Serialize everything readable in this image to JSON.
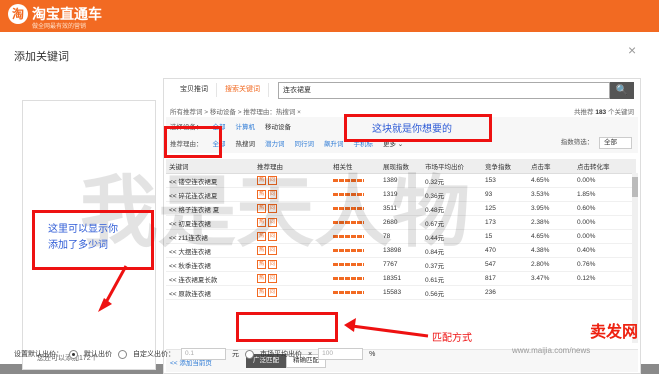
{
  "app": {
    "logo_glyph": "淘",
    "name": "淘宝直通车",
    "tagline": "做全网最有效的营销"
  },
  "dialog": {
    "title": "添加关键词",
    "close": "×"
  },
  "tabs": [
    {
      "label": "宝贝推词"
    },
    {
      "label": "搜索关键词"
    }
  ],
  "search": {
    "value": "连衣裙夏",
    "button": "🔍"
  },
  "breadcrumb": "所有推荐词 > 移动设备 > 推荐理由：热搜词 ×",
  "total": {
    "prefix": "共推荐",
    "count": "183",
    "suffix": "个关键词"
  },
  "filters": {
    "device_label": "选择设备：",
    "device_options": [
      "全部",
      "计算机",
      "移动设备"
    ],
    "reason_label": "推荐理由：",
    "reason_options": [
      "全部",
      "热搜词",
      "潜力词",
      "同行词",
      "飙升词",
      "手机标"
    ],
    "more": "更多 ⌄",
    "index_filter_label": "指数筛选：",
    "index_filter_value": "全部"
  },
  "table": {
    "headers": [
      "关键词",
      "推荐理由",
      "相关性",
      "展现指数",
      "市场平均出价",
      "竞争指数",
      "点击率",
      "点击转化率"
    ],
    "reason_badges": [
      "热",
      "同"
    ],
    "rows": [
      {
        "keyword": "<< 镂空连衣裙夏",
        "impressions": "1389",
        "avg_bid": "0.32元",
        "competition": "153",
        "ctr": "4.65%",
        "cvr": "0.00%"
      },
      {
        "keyword": "<< 碎花连衣裙夏",
        "impressions": "1319",
        "avg_bid": "0.36元",
        "competition": "93",
        "ctr": "3.53%",
        "cvr": "1.85%"
      },
      {
        "keyword": "<< 格子连衣裙 夏",
        "impressions": "3511",
        "avg_bid": "0.48元",
        "competition": "125",
        "ctr": "3.95%",
        "cvr": "0.60%"
      },
      {
        "keyword": "<< 初夏连衣裙",
        "impressions": "2680",
        "avg_bid": "0.67元",
        "competition": "173",
        "ctr": "2.38%",
        "cvr": "0.00%"
      },
      {
        "keyword": "<< z11连衣裙",
        "impressions": "78",
        "avg_bid": "0.44元",
        "competition": "15",
        "ctr": "4.65%",
        "cvr": "0.00%"
      },
      {
        "keyword": "<< 大摆连衣裙",
        "impressions": "13898",
        "avg_bid": "0.84元",
        "competition": "470",
        "ctr": "4.38%",
        "cvr": "0.40%"
      },
      {
        "keyword": "<< 秋季连衣裙",
        "impressions": "7767",
        "avg_bid": "0.37元",
        "competition": "547",
        "ctr": "2.80%",
        "cvr": "0.76%"
      },
      {
        "keyword": "<< 连衣裙夏长款",
        "impressions": "18351",
        "avg_bid": "0.61元",
        "competition": "817",
        "ctr": "3.47%",
        "cvr": "0.12%"
      },
      {
        "keyword": "<< 原款连衣裙",
        "impressions": "15583",
        "avg_bid": "0.56元",
        "competition": "236",
        "ctr": "",
        "cvr": ""
      }
    ]
  },
  "bottom": {
    "add_page": "<< 添加当前页",
    "match_broad": "广泛匹配",
    "match_exact": "精确匹配"
  },
  "left_panel": {
    "count_text": "您还可以添加172个"
  },
  "bid": {
    "label": "设置默认出价：",
    "opt_default": "默认出价",
    "opt_custom": "自定义出价：",
    "custom_placeholder": "0.1",
    "unit": "元",
    "opt_market": "市场平均出价",
    "multiply": "×",
    "percent_placeholder": "100",
    "percent": "%"
  },
  "annotations": {
    "this_is_wanted": "这块就是你想要的",
    "left_note_1": "这里可以显示你",
    "left_note_2": "添加了多少词",
    "match_note": "匹配方式"
  },
  "watermark": {
    "text": "我是天人物",
    "site_logo": "卖发网",
    "url": "www.maijia.com/news"
  },
  "colors": {
    "brand_orange": "#f26a22",
    "annotation_red": "#e11111",
    "annotation_blue": "#2e5bd6",
    "link_blue": "#2e7bd6"
  }
}
